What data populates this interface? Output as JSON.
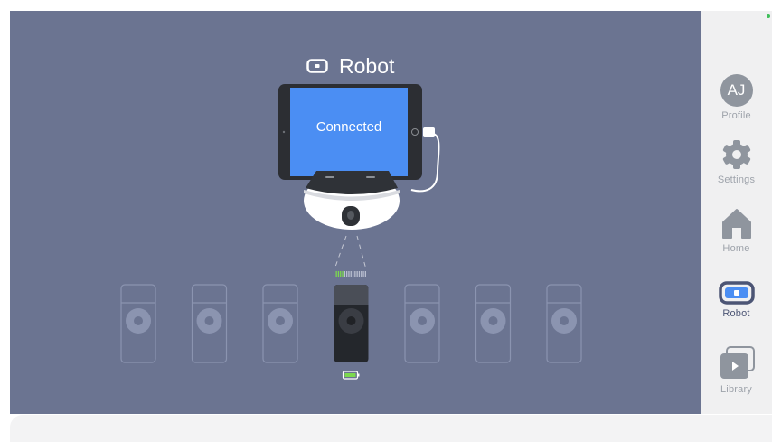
{
  "header": {
    "title": "Robot",
    "title_icon": "robot-icon"
  },
  "device": {
    "screen_status": "Connected",
    "tablet_icon": "tablet-icon",
    "robot_icon": "robot-base-icon"
  },
  "sensors": {
    "count": 7,
    "active_index": 3,
    "signal_bars_total": 15,
    "signal_bars_lit": 4,
    "battery_icon": "battery-icon",
    "battery_color": "#7cd94e"
  },
  "sidebar": {
    "items": [
      {
        "id": "profile",
        "label": "Profile",
        "avatar_initials": "AJ",
        "icon": "avatar-icon",
        "active": false
      },
      {
        "id": "settings",
        "label": "Settings",
        "icon": "gear-icon",
        "active": false
      },
      {
        "id": "home",
        "label": "Home",
        "icon": "home-icon",
        "active": false
      },
      {
        "id": "robot",
        "label": "Robot",
        "icon": "robot-icon",
        "active": true
      },
      {
        "id": "library",
        "label": "Library",
        "icon": "play-library-icon",
        "active": false
      }
    ]
  },
  "colors": {
    "stage_background": "#6b7491",
    "accent": "#4c5575",
    "screen_blue": "#4b8ef3",
    "status_dot": "#3fbf5a"
  }
}
